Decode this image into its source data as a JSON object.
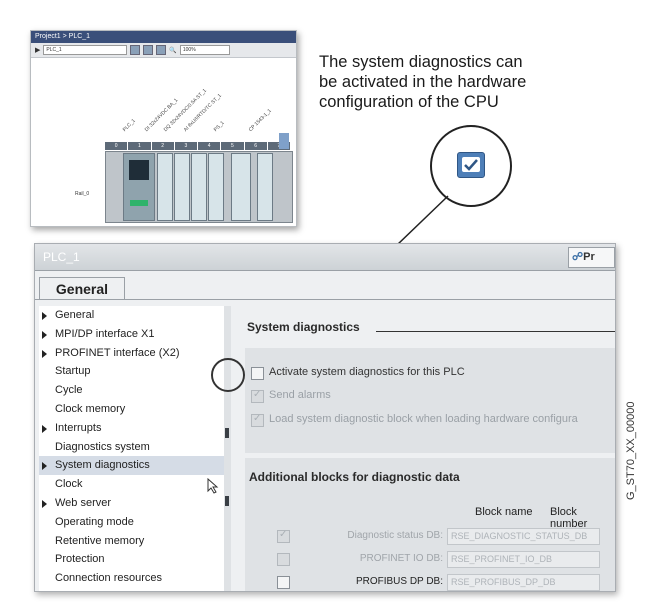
{
  "hardware_view": {
    "title": "Project1 > PLC_1",
    "device_select": "PLC_1",
    "zoom": "100%",
    "slot_numbers": [
      "0",
      "1",
      "2",
      "3",
      "4",
      "5",
      "6",
      "7"
    ],
    "module_labels": [
      "PLC_1",
      "DI 32x24VDC BA_1",
      "DQ 32x24VDC/0.5A ST_1",
      "AI 8xU/I/RTD/TC ST_1",
      "PS_1",
      "CP 1543-1_1"
    ],
    "rail_label": "Rail_0"
  },
  "callout": {
    "line1": "The system diagnostics can",
    "line2": "be activated in the hardware",
    "line3": "configuration of the CPU"
  },
  "properties": {
    "window_title": "PLC_1",
    "properties_button": "Pr",
    "tab_general": "General",
    "nav_items": [
      {
        "label": "General",
        "expandable": true
      },
      {
        "label": "MPI/DP interface X1",
        "expandable": true
      },
      {
        "label": "PROFINET interface (X2)",
        "expandable": true
      },
      {
        "label": "Startup",
        "expandable": false
      },
      {
        "label": "Cycle",
        "expandable": false
      },
      {
        "label": "Clock memory",
        "expandable": false
      },
      {
        "label": "Interrupts",
        "expandable": true
      },
      {
        "label": "Diagnostics system",
        "expandable": false
      },
      {
        "label": "System diagnostics",
        "expandable": true,
        "selected": true
      },
      {
        "label": "Clock",
        "expandable": false
      },
      {
        "label": "Web server",
        "expandable": true
      },
      {
        "label": "Operating mode",
        "expandable": false
      },
      {
        "label": "Retentive memory",
        "expandable": false
      },
      {
        "label": "Protection",
        "expandable": false
      },
      {
        "label": "Connection resources",
        "expandable": false
      }
    ],
    "system_diagnostics": {
      "section_title": "System diagnostics",
      "activate_label": "Activate system diagnostics for this PLC",
      "activate_checked": false,
      "send_alarms_label": "Send alarms",
      "load_block_label": "Load system diagnostic block when loading hardware configura"
    },
    "additional_blocks": {
      "section_title": "Additional blocks for diagnostic data",
      "col_block_name": "Block name",
      "col_block_number": "Block number",
      "rows": [
        {
          "label": "Diagnostic status DB:",
          "value": "RSE_DIAGNOSTIC_STATUS_DB",
          "checked": true,
          "enabled": false
        },
        {
          "label": "PROFINET IO DB:",
          "value": "RSE_PROFINET_IO_DB",
          "checked": false,
          "enabled": false
        },
        {
          "label": "PROFIBUS DP DB:",
          "value": "RSE_PROFIBUS_DP_DB",
          "checked": false,
          "enabled": true
        }
      ]
    }
  },
  "figure_id": "G_ST70_XX_00000",
  "colors": {
    "accent_check": "#4e7fb8",
    "selected_row": "#d5dce6"
  }
}
